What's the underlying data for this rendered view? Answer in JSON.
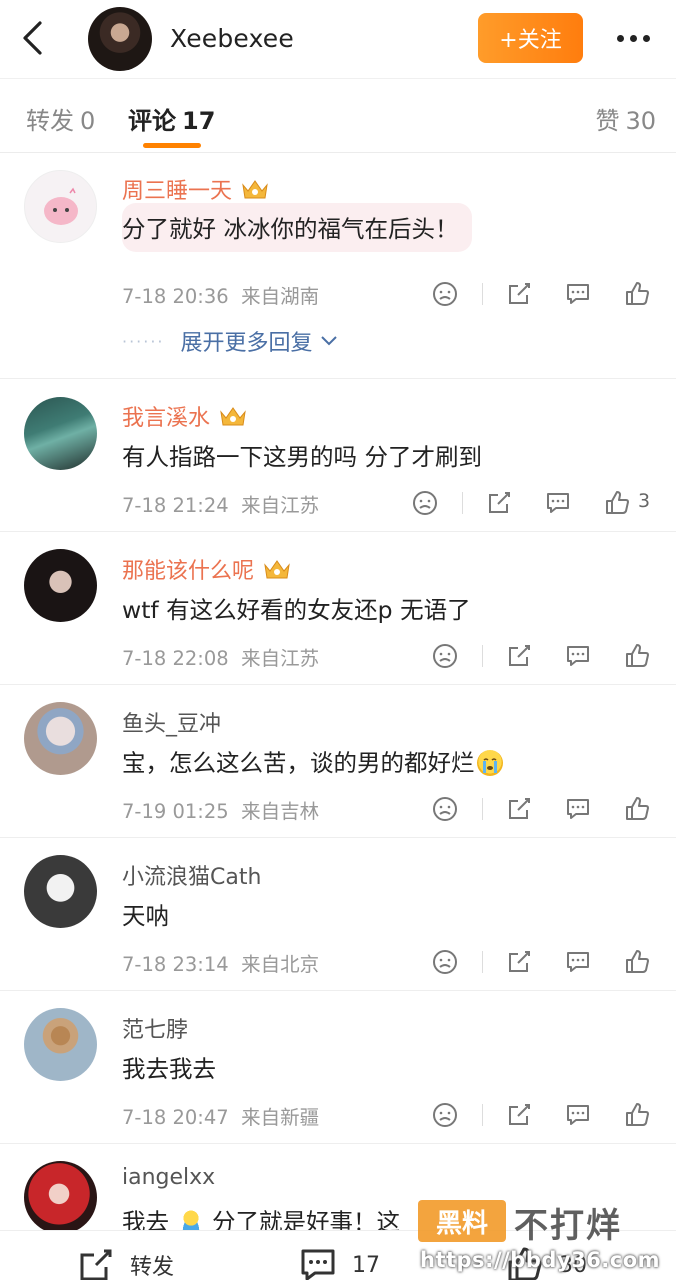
{
  "header": {
    "username": "Xeebexee",
    "follow_label": "+关注"
  },
  "tabs": {
    "repost_label": "转发",
    "repost_count": "0",
    "comment_label": "评论",
    "comment_count": "17",
    "like_label": "赞",
    "like_count": "30"
  },
  "comments": [
    {
      "name": "周三睡一天",
      "vip": true,
      "text": "分了就好 冰冰你的福气在后头！",
      "time": "7-18 20:36",
      "location": "来自湖南",
      "likes": "",
      "expand_label": "展开更多回复",
      "expand_dots": "······"
    },
    {
      "name": "我言溪水",
      "vip": true,
      "text": "有人指路一下这男的吗 分了才刷到",
      "time": "7-18 21:24",
      "location": "来自江苏",
      "likes": "3"
    },
    {
      "name": "那能该什么呢",
      "vip": true,
      "text": "wtf 有这么好看的女友还p 无语了",
      "time": "7-18 22:08",
      "location": "来自江苏",
      "likes": ""
    },
    {
      "name": "鱼头_豆冲",
      "vip": false,
      "text": "宝，怎么这么苦，谈的男的都好烂",
      "time": "7-19 01:25",
      "location": "来自吉林",
      "likes": ""
    },
    {
      "name": "小流浪猫Cath",
      "vip": false,
      "text": "天呐",
      "time": "7-18 23:14",
      "location": "来自北京",
      "likes": ""
    },
    {
      "name": "范七脖",
      "vip": false,
      "text": "我去我去",
      "time": "7-18 20:47",
      "location": "来自新疆",
      "likes": ""
    },
    {
      "name": "iangelxx",
      "vip": false,
      "text_part1": "我去",
      "text_part2": "分了就是好事！这",
      "time": "",
      "location": "",
      "likes": ""
    }
  ],
  "bottom_bar": {
    "repost_label": "转发",
    "comment_count": "17",
    "like_count": "30"
  },
  "watermark": {
    "logo_text": "黑料",
    "title": "不打烊",
    "url": "https://bbdy36.com"
  },
  "colors": {
    "accent": "#ff8200",
    "vip_name": "#eb7350",
    "link": "#4a6fa5"
  }
}
